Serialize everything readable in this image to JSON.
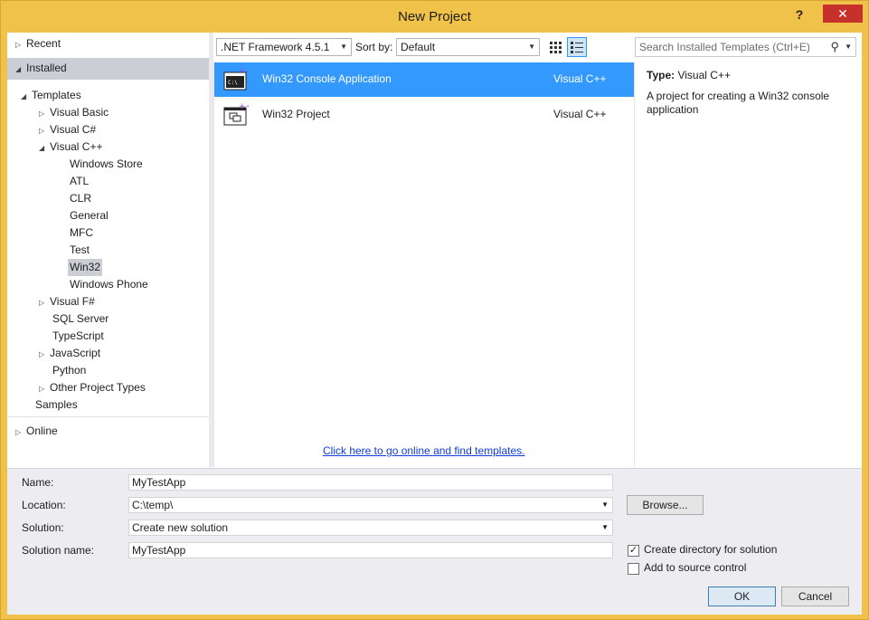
{
  "window": {
    "title": "New Project",
    "help": "?",
    "close": "✕"
  },
  "tree": {
    "recent": "Recent",
    "installed": "Installed",
    "templates": "Templates",
    "visual_basic": "Visual Basic",
    "visual_csharp": "Visual C#",
    "visual_cpp": "Visual C++",
    "cpp_children": [
      "Windows Store",
      "ATL",
      "CLR",
      "General",
      "MFC",
      "Test",
      "Win32",
      "Windows Phone"
    ],
    "visual_fsharp": "Visual F#",
    "sql_server": "SQL Server",
    "typescript": "TypeScript",
    "javascript": "JavaScript",
    "python": "Python",
    "other_project_types": "Other Project Types",
    "samples": "Samples",
    "online": "Online"
  },
  "toolbar": {
    "framework": ".NET Framework 4.5.1",
    "sort_label": "Sort by:",
    "sort_value": "Default",
    "search_placeholder": "Search Installed Templates (Ctrl+E)"
  },
  "templates": [
    {
      "name": "Win32 Console Application",
      "lang": "Visual C++",
      "selected": true
    },
    {
      "name": "Win32 Project",
      "lang": "Visual C++",
      "selected": false
    }
  ],
  "online_link": "Click here to go online and find templates.",
  "details": {
    "type_label": "Type:",
    "type_value": "Visual C++",
    "description": "A project for creating a Win32 console application"
  },
  "form": {
    "name_label": "Name:",
    "name_value": "MyTestApp",
    "location_label": "Location:",
    "location_value": "C:\\temp\\",
    "solution_label": "Solution:",
    "solution_value": "Create new solution",
    "solution_name_label": "Solution name:",
    "solution_name_value": "MyTestApp",
    "browse": "Browse...",
    "create_dir": "Create directory for solution",
    "add_source": "Add to source control",
    "ok": "OK",
    "cancel": "Cancel"
  },
  "colors": {
    "accent": "#3399ff",
    "frame": "#f0c24a",
    "close": "#c7312c"
  }
}
